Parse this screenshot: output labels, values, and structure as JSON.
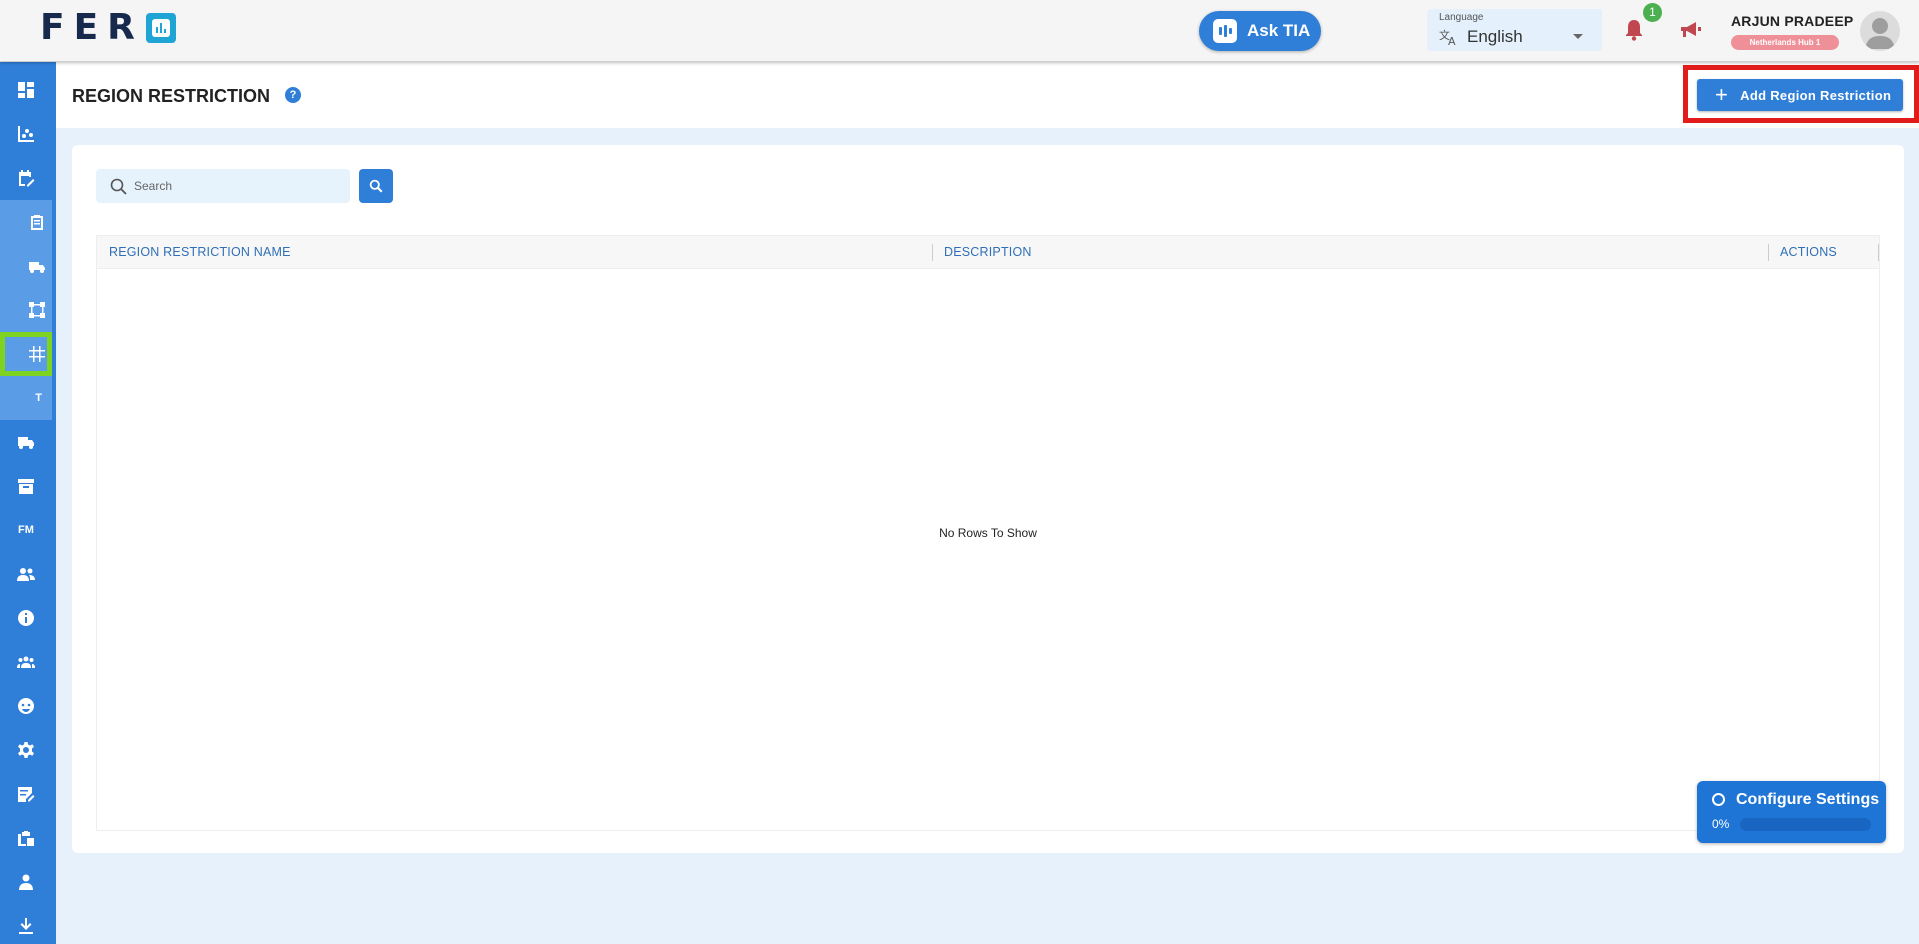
{
  "header": {
    "logo_text": "FER",
    "ask_tia_label": "Ask TIA",
    "language": {
      "label": "Language",
      "value": "English"
    },
    "notifications_count": "1",
    "user": {
      "name": "ARJUN PRADEEP",
      "hub": "Netherlands Hub 1"
    }
  },
  "sidebar": {
    "items": [
      {
        "icon": "dashboard-icon"
      },
      {
        "icon": "analytics-icon"
      },
      {
        "icon": "calendar-edit-icon"
      },
      {
        "icon": "clipboard-icon",
        "sub": true
      },
      {
        "icon": "truck-icon",
        "sub": true
      },
      {
        "icon": "route-map-icon",
        "sub": true
      },
      {
        "icon": "grid-hash-icon",
        "sub": true,
        "active": true
      },
      {
        "icon": "text-t-icon",
        "sub": true,
        "text": "T"
      },
      {
        "icon": "delivery-truck-icon"
      },
      {
        "icon": "archive-icon"
      },
      {
        "icon": "fm-icon",
        "text": "FM"
      },
      {
        "icon": "users-icon"
      },
      {
        "icon": "info-icon"
      },
      {
        "icon": "groups-icon"
      },
      {
        "icon": "face-icon"
      },
      {
        "icon": "settings-icon"
      },
      {
        "icon": "note-edit-icon"
      },
      {
        "icon": "report-icon"
      },
      {
        "icon": "person-icon"
      },
      {
        "icon": "download-icon"
      }
    ]
  },
  "page": {
    "title": "REGION RESTRICTION",
    "help": "?",
    "add_button_label": "Add Region Restriction"
  },
  "search": {
    "placeholder": "Search"
  },
  "table": {
    "columns": [
      "REGION RESTRICTION NAME",
      "DESCRIPTION",
      "ACTIONS"
    ],
    "rows": [],
    "empty_text": "No Rows To Show"
  },
  "config_widget": {
    "title": "Configure Settings",
    "progress_text": "0%",
    "progress": 0
  },
  "colors": {
    "primary": "#2f7ed8",
    "highlight_red": "#e21b1b",
    "highlight_green": "#7ed321",
    "badge_green": "#4caf50",
    "hub_pink": "#ef8f98"
  }
}
